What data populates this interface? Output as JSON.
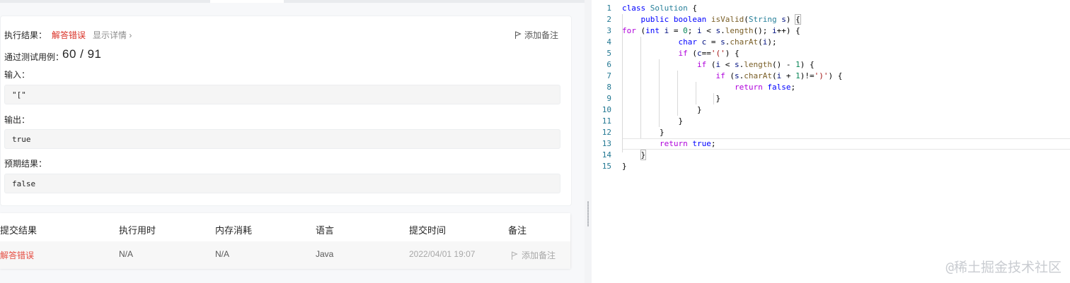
{
  "result": {
    "status_label": "执行结果：",
    "status_value": "解答错误",
    "details_link": "显示详情 ›",
    "add_note": "添加备注",
    "cases_label": "通过测试用例：",
    "cases_value": "60 / 91",
    "input_label": "输入：",
    "input_value": "\"[\"",
    "output_label": "输出：",
    "output_value": "true",
    "expected_label": "预期结果：",
    "expected_value": "false"
  },
  "submissions": {
    "headers": [
      "提交结果",
      "执行用时",
      "内存消耗",
      "语言",
      "提交时间",
      "备注"
    ],
    "row": {
      "result": "解答错误",
      "runtime": "N/A",
      "memory": "N/A",
      "language": "Java",
      "time": "2022/04/01 19:07",
      "note": "添加备注"
    }
  },
  "editor": {
    "line_numbers": [
      "1",
      "2",
      "3",
      "4",
      "5",
      "6",
      "7",
      "8",
      "9",
      "10",
      "11",
      "12",
      "13",
      "14",
      "15"
    ]
  },
  "watermark": "@稀土掘金技术社区",
  "colors": {
    "error": "#e54d42",
    "keyword": "#0000ff",
    "line_number": "#237893"
  }
}
